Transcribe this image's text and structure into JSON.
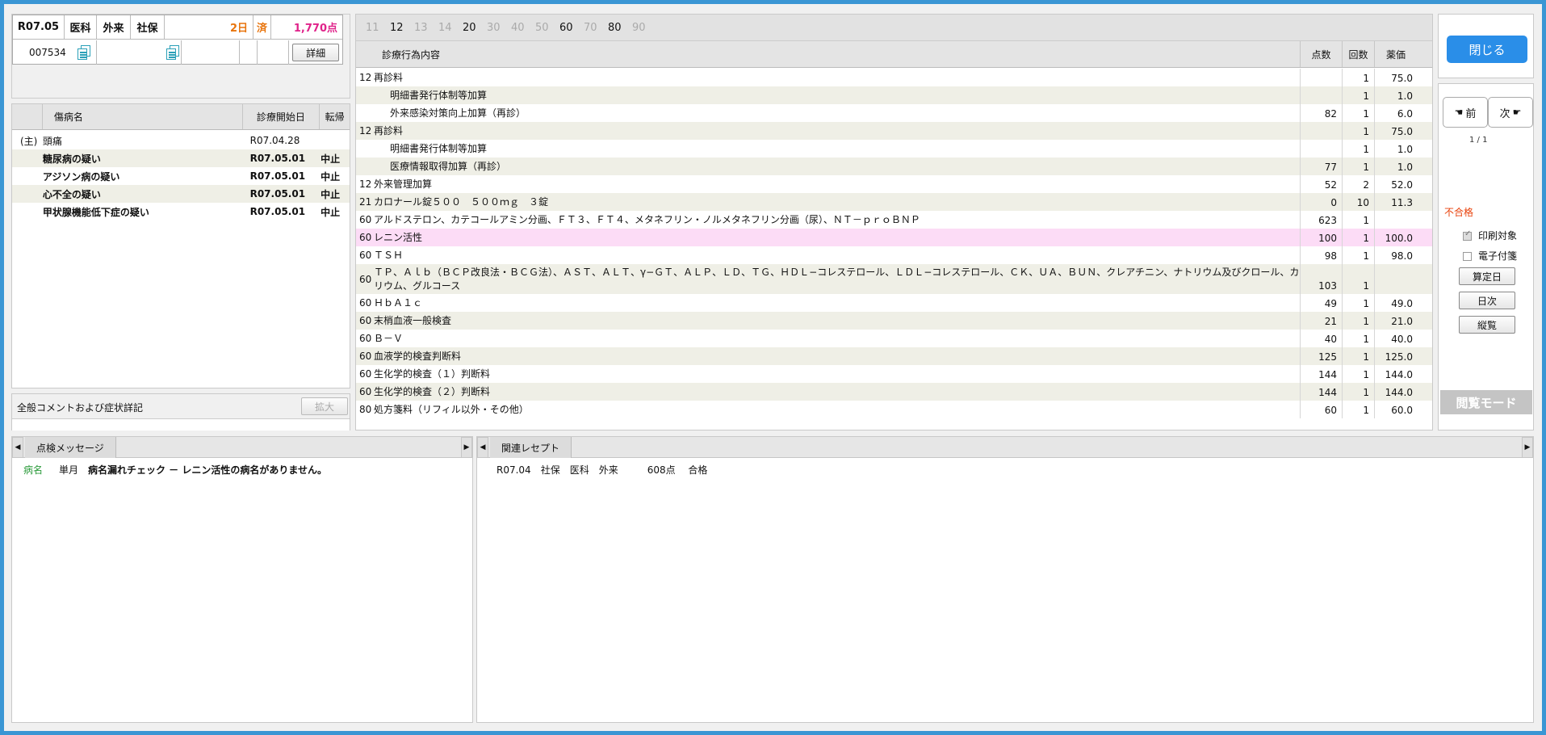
{
  "header": {
    "era": "R07.05",
    "dept": "医科",
    "type": "外来",
    "insurance": "社保",
    "days": "2日",
    "status": "済",
    "points": "1,770点",
    "patient_id": "007534",
    "detail_button": "詳細"
  },
  "diseases": {
    "columns": [
      "傷病名",
      "診療開始日",
      "転帰"
    ],
    "rows": [
      {
        "mark": "(主)",
        "name": "頭痛",
        "date": "R07.04.28",
        "outcome": ""
      },
      {
        "mark": "",
        "name": "糖尿病の疑い",
        "date": "R07.05.01",
        "outcome": "中止"
      },
      {
        "mark": "",
        "name": "アジソン病の疑い",
        "date": "R07.05.01",
        "outcome": "中止"
      },
      {
        "mark": "",
        "name": "心不全の疑い",
        "date": "R07.05.01",
        "outcome": "中止"
      },
      {
        "mark": "",
        "name": "甲状腺機能低下症の疑い",
        "date": "R07.05.01",
        "outcome": "中止"
      }
    ]
  },
  "comment": {
    "label": "全般コメントおよび症状詳記",
    "expand_button": "拡大"
  },
  "act_tabs": [
    "11",
    "12",
    "13",
    "14",
    "20",
    "30",
    "40",
    "50",
    "60",
    "70",
    "80",
    "90"
  ],
  "act_tabs_active": [
    "12",
    "20",
    "60",
    "80"
  ],
  "acts": {
    "columns": [
      "診療行為内容",
      "点数",
      "回数",
      "薬価"
    ],
    "rows": [
      {
        "code": "12",
        "name": "再診料",
        "points": "",
        "count": "1",
        "price": "75.0",
        "indent": false,
        "h": 18
      },
      {
        "code": "",
        "name": "明細書発行体制等加算",
        "points": "",
        "count": "1",
        "price": "1.0",
        "indent": true,
        "h": 18
      },
      {
        "code": "",
        "name": "外来感染対策向上加算（再診）",
        "points": "82",
        "count": "1",
        "price": "6.0",
        "indent": true,
        "h": 18
      },
      {
        "code": "12",
        "name": "再診料",
        "points": "",
        "count": "1",
        "price": "75.0",
        "indent": false,
        "h": 18
      },
      {
        "code": "",
        "name": "明細書発行体制等加算",
        "points": "",
        "count": "1",
        "price": "1.0",
        "indent": true,
        "h": 18
      },
      {
        "code": "",
        "name": "医療情報取得加算（再診）",
        "points": "77",
        "count": "1",
        "price": "1.0",
        "indent": true,
        "h": 18
      },
      {
        "code": "12",
        "name": "外来管理加算",
        "points": "52",
        "count": "2",
        "price": "52.0",
        "indent": false,
        "h": 18
      },
      {
        "code": "21",
        "name": "カロナール錠５００　５００ｍｇ　３錠",
        "points": "0",
        "count": "10",
        "price": "11.3",
        "indent": false,
        "h": 18
      },
      {
        "code": "60",
        "name": "アルドステロン、カテコールアミン分画、ＦＴ３、ＦＴ４、メタネフリン・ノルメタネフリン分画（尿）、ＮＴ－ｐｒｏＢＮＰ",
        "points": "623",
        "count": "1",
        "price": "",
        "indent": false,
        "h": 18
      },
      {
        "code": "60",
        "name": "レニン活性",
        "points": "100",
        "count": "1",
        "price": "100.0",
        "indent": false,
        "h": 18
      },
      {
        "code": "60",
        "name": "ＴＳＨ",
        "points": "98",
        "count": "1",
        "price": "98.0",
        "indent": false,
        "h": 18
      },
      {
        "code": "60",
        "name": "ＴＰ、Ａｌｂ（ＢＣＰ改良法・ＢＣＧ法）、ＡＳＴ、ＡＬＴ、γ−ＧＴ、ＡＬＰ、ＬＤ、ＴＧ、ＨＤＬ−コレステロール、ＬＤＬ−コレステロール、ＣＫ、ＵＡ、ＢＵＮ、クレアチニン、ナトリウム及びクロール、カリウム、グルコース",
        "points": "103",
        "count": "1",
        "price": "",
        "indent": false,
        "h": 33
      },
      {
        "code": "60",
        "name": "ＨｂＡ１ｃ",
        "points": "49",
        "count": "1",
        "price": "49.0",
        "indent": false,
        "h": 18
      },
      {
        "code": "60",
        "name": "末梢血液一般検査",
        "points": "21",
        "count": "1",
        "price": "21.0",
        "indent": false,
        "h": 18
      },
      {
        "code": "60",
        "name": "Ｂ－Ｖ",
        "points": "40",
        "count": "1",
        "price": "40.0",
        "indent": false,
        "h": 18
      },
      {
        "code": "60",
        "name": "血液学的検査判断料",
        "points": "125",
        "count": "1",
        "price": "125.0",
        "indent": false,
        "h": 18
      },
      {
        "code": "60",
        "name": "生化学的検査（１）判断料",
        "points": "144",
        "count": "1",
        "price": "144.0",
        "indent": false,
        "h": 18
      },
      {
        "code": "60",
        "name": "生化学的検査（２）判断料",
        "points": "144",
        "count": "1",
        "price": "144.0",
        "indent": false,
        "h": 18
      },
      {
        "code": "80",
        "name": "処方箋料（リフィル以外・その他）",
        "points": "60",
        "count": "1",
        "price": "60.0",
        "indent": false,
        "h": 18
      }
    ]
  },
  "check_messages": {
    "tab": "点検メッセージ",
    "rows": [
      {
        "category": "病名",
        "scope": "単月",
        "message": "病名漏れチェック － レニン活性の病名がありません。"
      }
    ]
  },
  "related": {
    "tab": "関連レセプト",
    "rows": [
      {
        "text": "R07.04　社保　医科　外来　　　608点　 合格"
      }
    ]
  },
  "side": {
    "close_button": "閉じる",
    "prev_button": "前",
    "next_button": "次",
    "page": "1 / 1",
    "result": "不合格",
    "print_target": "印刷対象",
    "e_note": "電子付箋",
    "calc_day_button": "算定日",
    "daily_button": "日次",
    "vertical_button": "縦覧",
    "mode": "閲覧モード"
  },
  "colors": {
    "frame": "#3a96d4",
    "accent_button": "#2a8ee8",
    "fail_text": "#e8420c",
    "highlight_row": "#fcdcf6",
    "alt_row": "#efefe6"
  }
}
